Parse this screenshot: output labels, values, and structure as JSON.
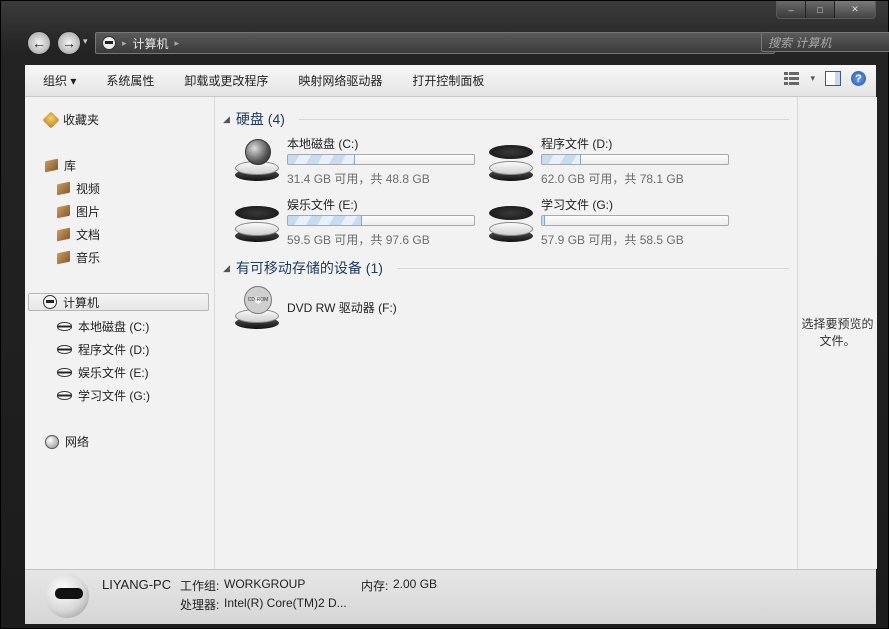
{
  "window": {
    "caption_buttons": [
      "–",
      "□",
      "✕"
    ]
  },
  "navigation": {
    "back_icon": "←",
    "forward_icon": "→",
    "recent_icon": "▾",
    "address": {
      "location": "计算机",
      "arrow": "▸"
    },
    "search_placeholder": "搜索 计算机"
  },
  "toolbar": {
    "organize": "组织 ▾",
    "system_properties": "系统属性",
    "uninstall": "卸载或更改程序",
    "map_drive": "映射网络驱动器",
    "control_panel": "打开控制面板",
    "help_icon": "?"
  },
  "sidebar": {
    "favorites": "收藏夹",
    "libraries": "库",
    "lib_items": [
      "视频",
      "图片",
      "文档",
      "音乐"
    ],
    "computer": "计算机",
    "drives": [
      "本地磁盘 (C:)",
      "程序文件 (D:)",
      "娱乐文件 (E:)",
      "学习文件 (G:)"
    ],
    "network": "网络"
  },
  "content": {
    "hdd_group": "硬盘 (4)",
    "removable_group": "有可移动存储的设备 (1)",
    "drives": [
      {
        "name": "本地磁盘 (C:)",
        "free": "31.4 GB 可用，共 48.8 GB",
        "used_fraction": 0.357
      },
      {
        "name": "程序文件 (D:)",
        "free": "62.0 GB 可用，共 78.1 GB",
        "used_fraction": 0.206
      },
      {
        "name": "娱乐文件 (E:)",
        "free": "59.5 GB 可用，共 97.6 GB",
        "used_fraction": 0.39
      },
      {
        "name": "学习文件 (G:)",
        "free": "57.9 GB 可用，共 58.5 GB",
        "used_fraction": 0.01
      }
    ],
    "dvd": {
      "name": "DVD RW 驱动器 (F:)",
      "label": "CD-ROM"
    }
  },
  "preview": {
    "text": "选择要预览的文件。"
  },
  "details": {
    "computer_name": "LIYANG-PC",
    "workgroup_label": "工作组:",
    "workgroup": "WORKGROUP",
    "memory_label": "内存:",
    "memory": "2.00 GB",
    "processor_label": "处理器:",
    "processor": "Intel(R) Core(TM)2 D..."
  }
}
